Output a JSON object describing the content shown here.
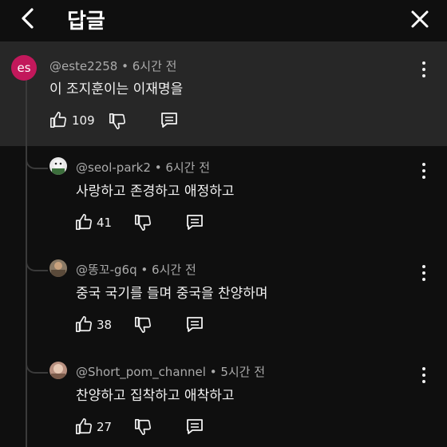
{
  "header": {
    "title": "답글"
  },
  "parent": {
    "avatar_initials": "es",
    "author": "@este2258",
    "time": "6시간 전",
    "text": "이 조지훈이는 이재명을",
    "likes": "109"
  },
  "replies": [
    {
      "author": "@seol-park2",
      "time": "6시간 전",
      "text": "사랑하고 존경하고 애정하고",
      "likes": "41"
    },
    {
      "author": "@똥꼬-g6q",
      "time": "6시간 전",
      "text": "중국 국기를 들며 중국을 찬양하며",
      "likes": "38"
    },
    {
      "author": "@Short_pom_channel",
      "time": "5시간 전",
      "text": "찬양하고 집착하고 애착하고",
      "likes": "27"
    }
  ],
  "separator": "•",
  "colors": {
    "background": "#0f0f0f",
    "highlight": "#272727",
    "avatar_es": "#c2185b",
    "meta": "#aaaaaa"
  }
}
